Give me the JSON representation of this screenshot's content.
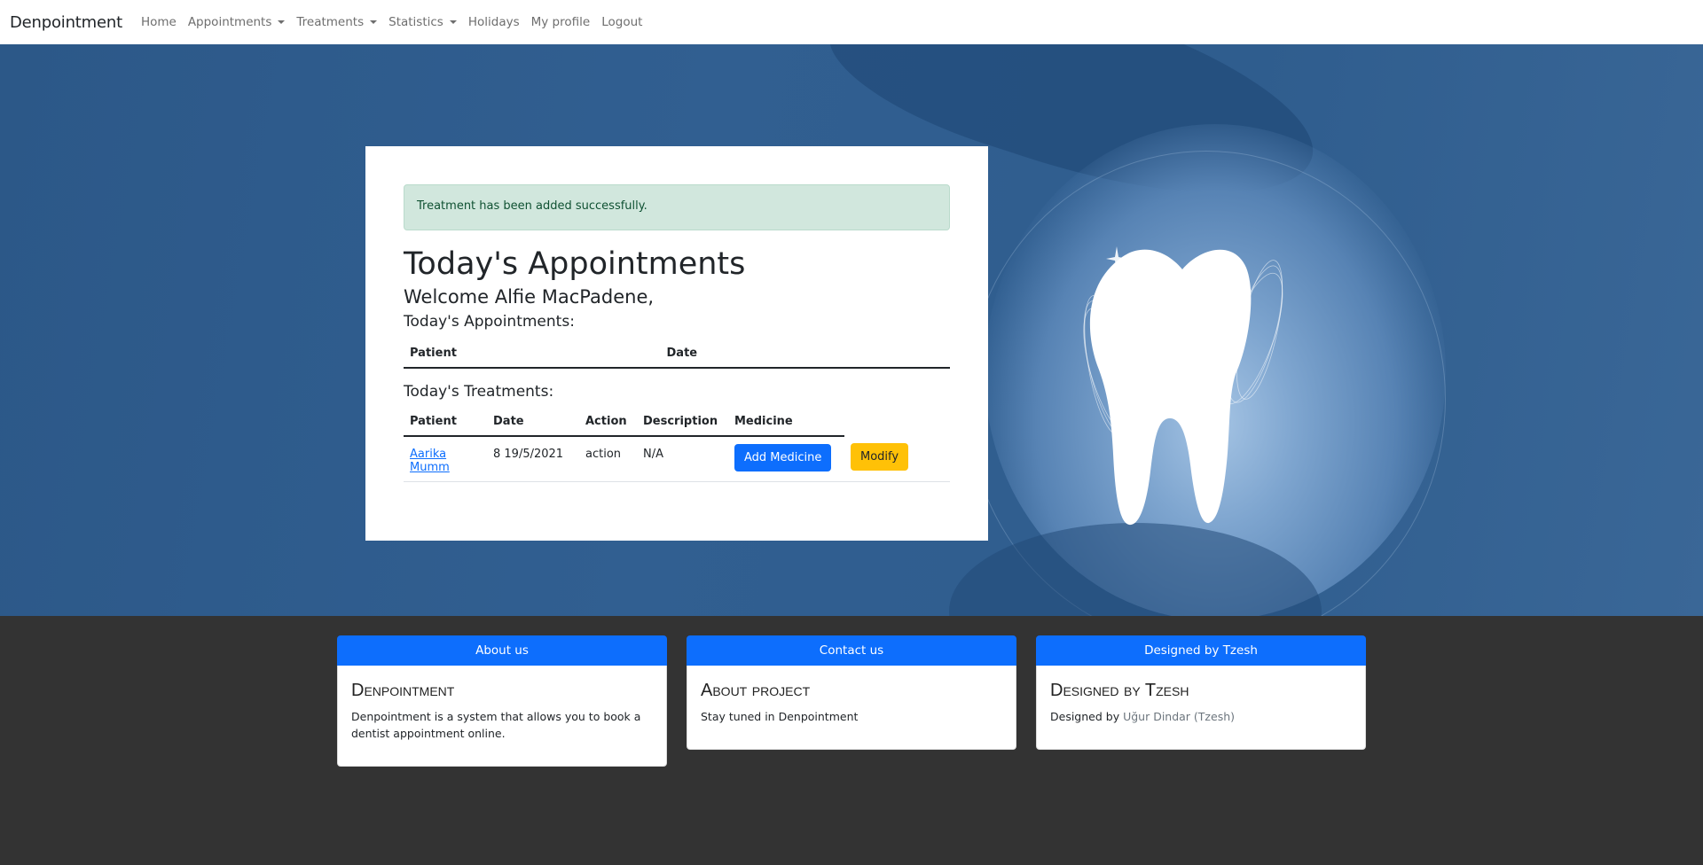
{
  "navbar": {
    "brand": "Denpointment",
    "items": [
      {
        "label": "Home",
        "dropdown": false
      },
      {
        "label": "Appointments",
        "dropdown": true
      },
      {
        "label": "Treatments",
        "dropdown": true
      },
      {
        "label": "Statistics",
        "dropdown": true
      },
      {
        "label": "Holidays",
        "dropdown": false
      },
      {
        "label": "My profile",
        "dropdown": false
      },
      {
        "label": "Logout",
        "dropdown": false
      }
    ]
  },
  "alert": {
    "message": "Treatment has been added successfully.",
    "type": "success"
  },
  "main": {
    "title": "Today's Appointments",
    "welcome": "Welcome Alfie MacPadene,",
    "appointments_label": "Today's Appointments:",
    "appointments_table": {
      "headers": [
        "Patient",
        "Date"
      ],
      "rows": []
    },
    "treatments_label": "Today's Treatments:",
    "treatments_table": {
      "headers": [
        "Patient",
        "Date",
        "Action",
        "Description",
        "Medicine"
      ],
      "rows": [
        {
          "patient": "Aarika Mumm",
          "date": "8 19/5/2021",
          "action": "action",
          "description": "N/A",
          "medicine_button": "Add Medicine",
          "modify_button": "Modify"
        }
      ]
    }
  },
  "footer": {
    "cards": [
      {
        "header": "About us",
        "title": "Denpointment",
        "text": "Denpointment is a system that allows you to book a dentist appointment online."
      },
      {
        "header": "Contact us",
        "title": "About project",
        "text": "Stay tuned in Denpointment"
      },
      {
        "header": "Designed by Tzesh",
        "title": "Designed by Tzesh",
        "text_prefix": "Designed by",
        "designer": "Uğur Dindar (Tzesh)"
      }
    ]
  },
  "colors": {
    "primary": "#0d6efd",
    "warning": "#ffc107",
    "success_bg": "#d1e7dd",
    "success_text": "#0f5132",
    "hero_blue": "#2f5d8e",
    "footer_bg": "#333333"
  },
  "hero": {
    "image": "tooth-illustration"
  }
}
